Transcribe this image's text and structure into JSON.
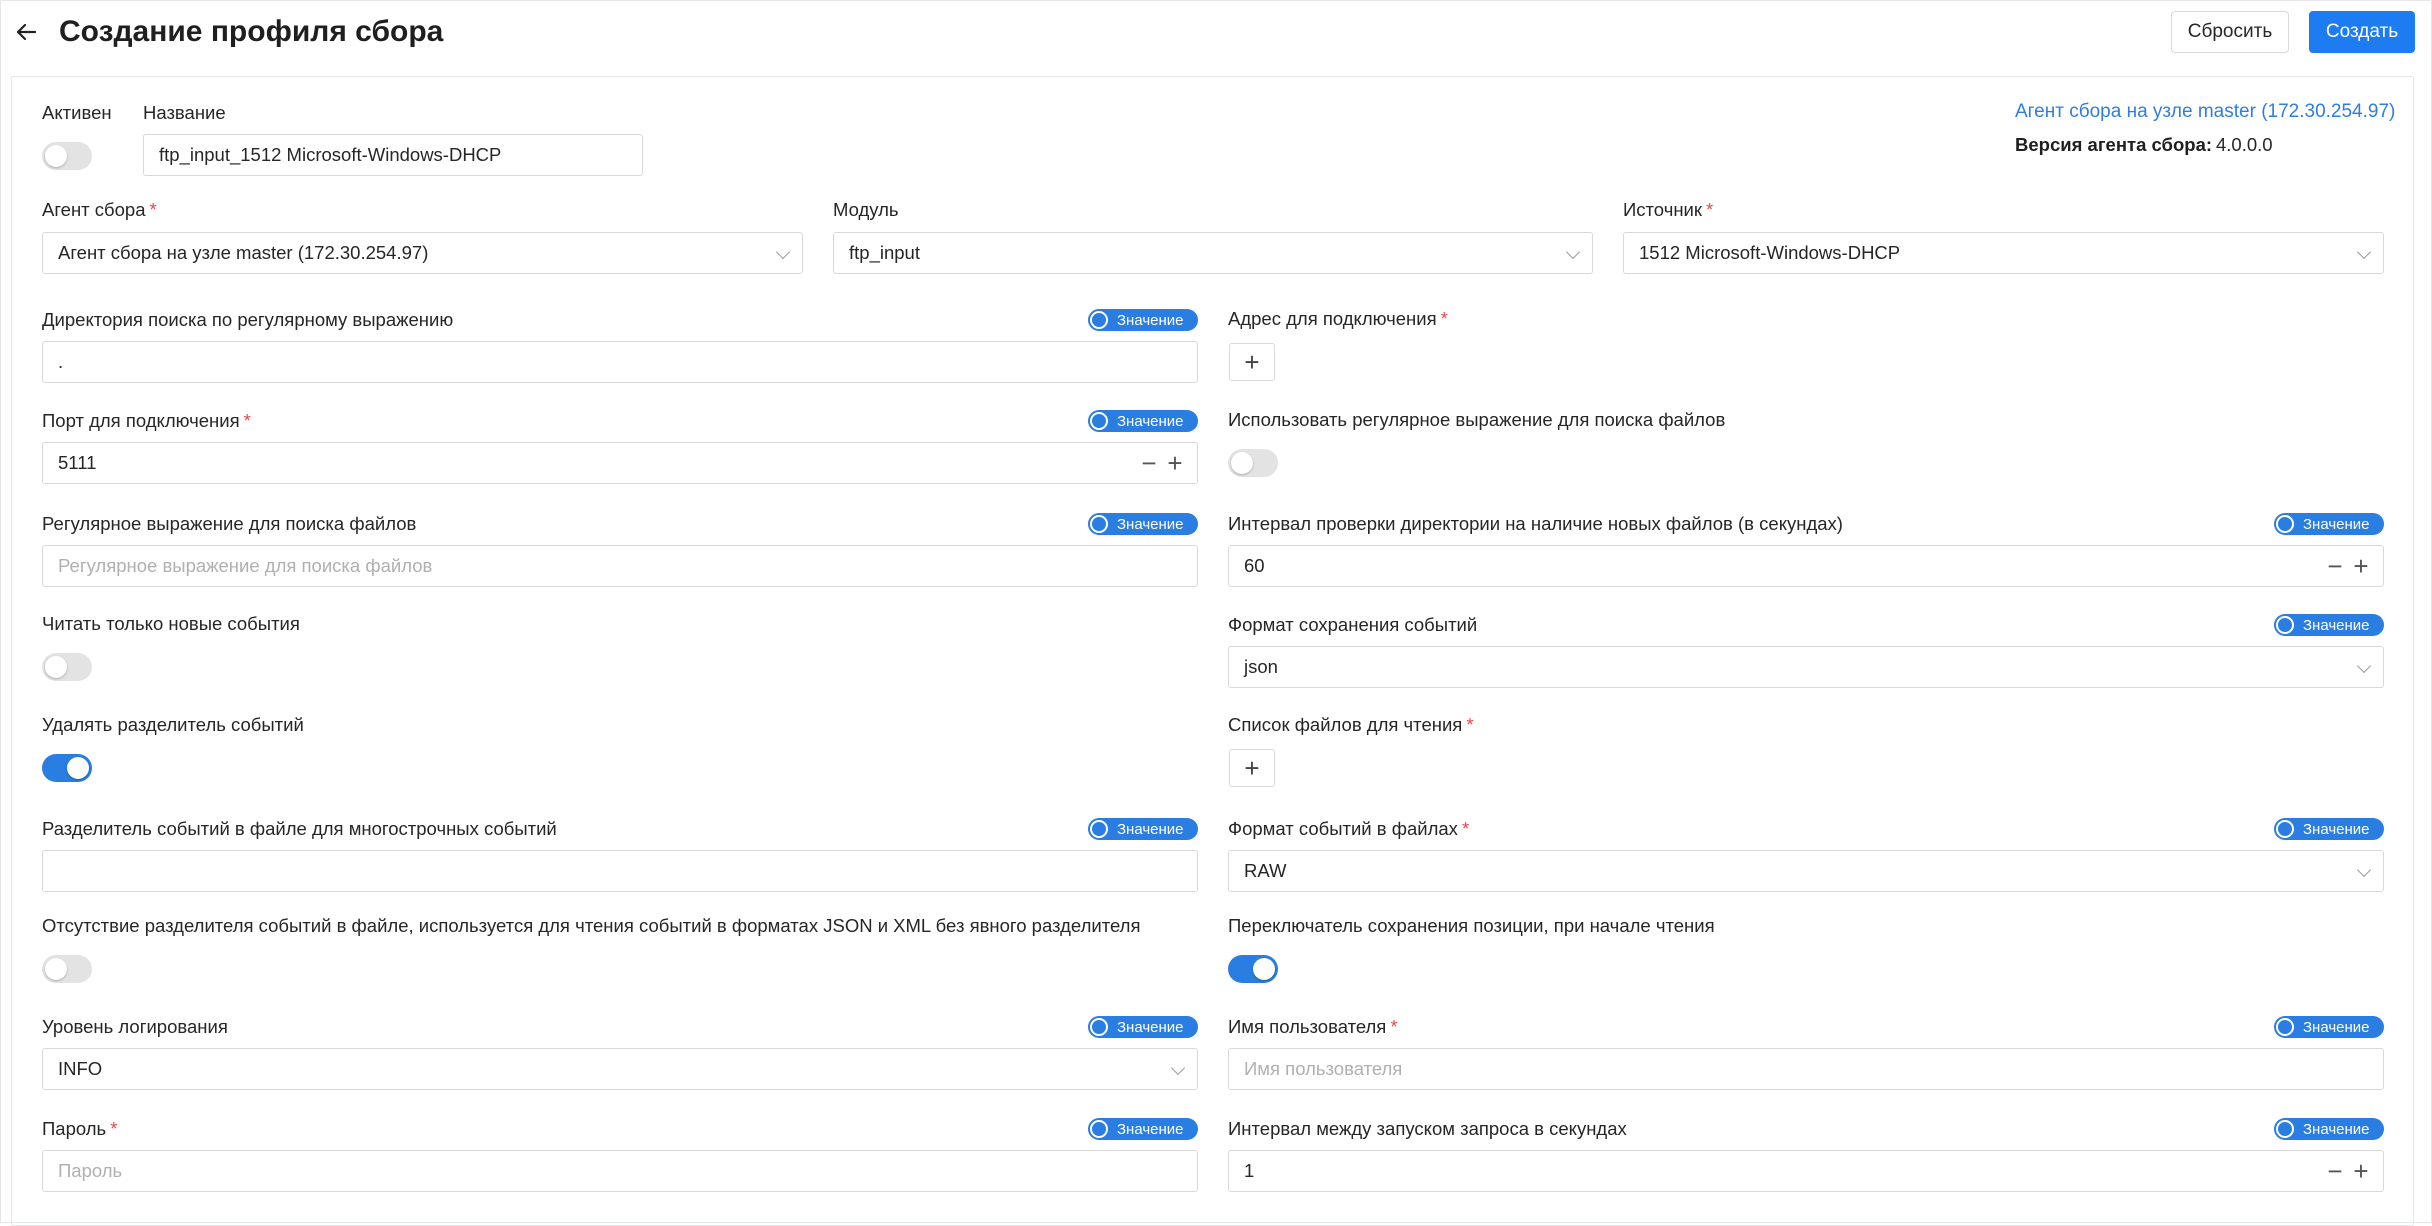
{
  "header": {
    "title": "Создание профиля сбора",
    "reset_label": "Сбросить",
    "create_label": "Создать"
  },
  "agent_info": {
    "link": "Агент сбора на узле master (172.30.254.97)",
    "version_label": "Версия агента сбора:",
    "version_value": "4.0.0.0"
  },
  "value_toggle_label": "Значение",
  "form": {
    "active": {
      "label": "Активен",
      "enabled": false
    },
    "name": {
      "label": "Название",
      "value": "ftp_input_1512 Microsoft-Windows-DHCP"
    },
    "agent": {
      "label": "Агент сбора",
      "required": "*",
      "value": "Агент сбора на узле master (172.30.254.97)"
    },
    "module": {
      "label": "Модуль",
      "value": "ftp_input"
    },
    "source": {
      "label": "Источник",
      "required": "*",
      "value": "1512 Microsoft-Windows-DHCP"
    },
    "search_dir": {
      "label": "Директория поиска по регулярному выражению",
      "value": "."
    },
    "address": {
      "label": "Адрес для подключения",
      "required": "*"
    },
    "port": {
      "label": "Порт для подключения",
      "required": "*",
      "value": "5111"
    },
    "use_regex": {
      "label": "Использовать регулярное выражение для поиска файлов",
      "enabled": false
    },
    "regex": {
      "label": "Регулярное выражение для поиска файлов",
      "placeholder": "Регулярное выражение для поиска файлов"
    },
    "check_interval": {
      "label": "Интервал проверки директории на наличие новых файлов (в секундах)",
      "value": "60"
    },
    "read_new_only": {
      "label": "Читать только новые события",
      "enabled": false
    },
    "save_format": {
      "label": "Формат сохранения событий",
      "value": "json"
    },
    "remove_delimiter": {
      "label": "Удалять разделитель событий",
      "enabled": true
    },
    "file_list": {
      "label": "Список файлов для чтения",
      "required": "*"
    },
    "multiline_delimiter": {
      "label": "Разделитель событий в файле для многострочных событий",
      "value": ""
    },
    "file_event_format": {
      "label": "Формат событий в файлах",
      "required": "*",
      "value": "RAW"
    },
    "no_delimiter": {
      "label": "Отсутствие разделителя событий в файле, используется для чтения событий в форматах JSON и XML без явного разделителя",
      "enabled": false
    },
    "save_position": {
      "label": "Переключатель сохранения позиции, при начале чтения",
      "enabled": true
    },
    "log_level": {
      "label": "Уровень логирования",
      "value": "INFO"
    },
    "username": {
      "label": "Имя пользователя",
      "required": "*",
      "placeholder": "Имя пользователя"
    },
    "password": {
      "label": "Пароль",
      "required": "*",
      "placeholder": "Пароль"
    },
    "request_interval": {
      "label": "Интервал между запуском запроса в секундах",
      "value": "1"
    }
  },
  "stepper": {
    "minus": "−",
    "plus": "+"
  },
  "plus_symbol": "+"
}
